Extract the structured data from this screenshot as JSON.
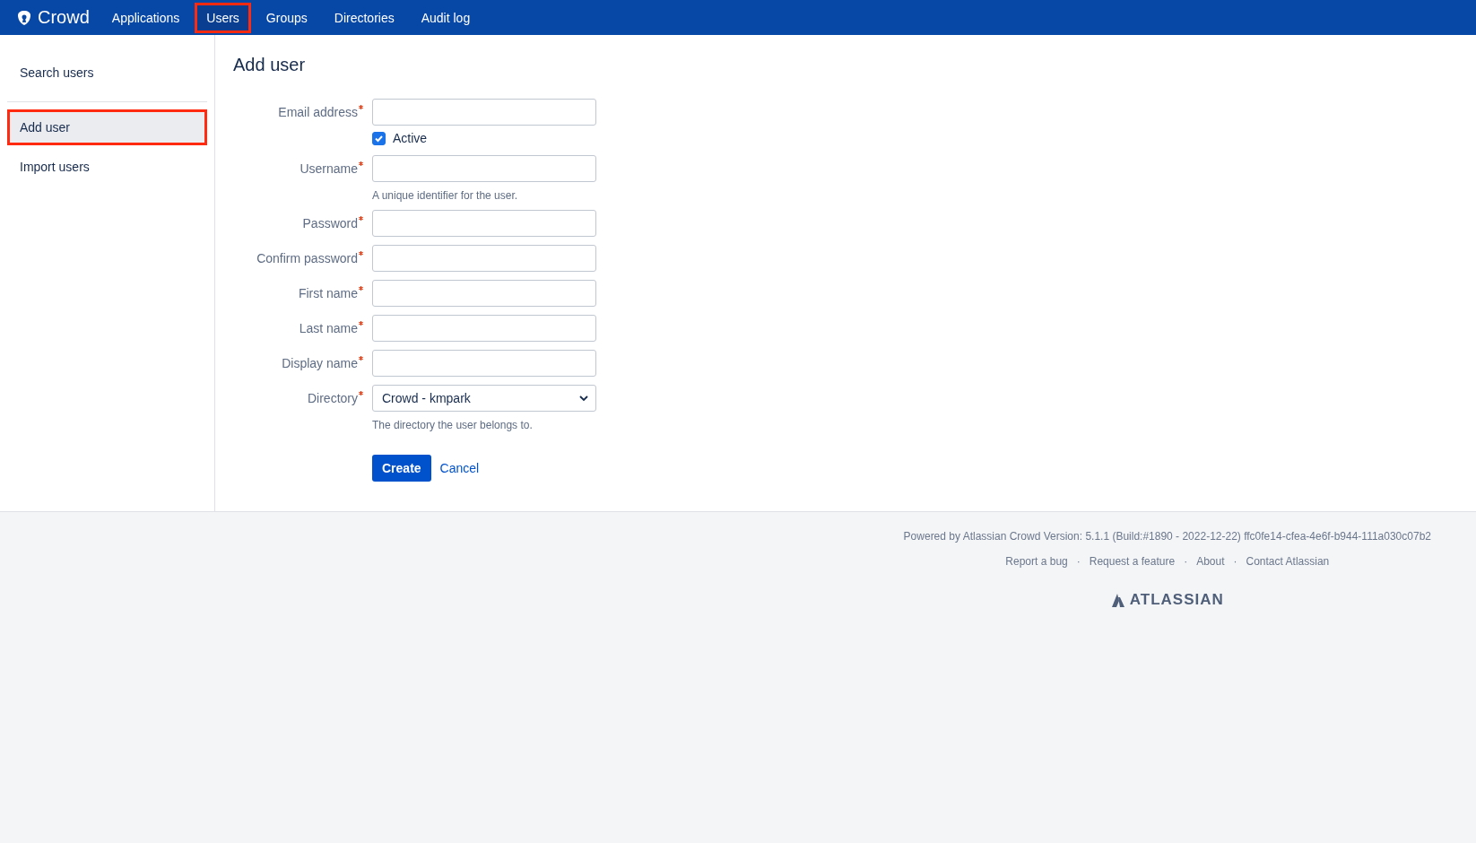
{
  "header": {
    "logo": "Crowd",
    "nav": [
      {
        "label": "Applications",
        "selected": false,
        "highlighted": false
      },
      {
        "label": "Users",
        "selected": true,
        "highlighted": true
      },
      {
        "label": "Groups",
        "selected": false,
        "highlighted": false
      },
      {
        "label": "Directories",
        "selected": false,
        "highlighted": false
      },
      {
        "label": "Audit log",
        "selected": false,
        "highlighted": false
      }
    ]
  },
  "sidebar": {
    "groups": [
      [
        {
          "label": "Search users",
          "selected": false,
          "highlighted": false
        }
      ],
      [
        {
          "label": "Add user",
          "selected": true,
          "highlighted": true
        },
        {
          "label": "Import users",
          "selected": false,
          "highlighted": false
        }
      ]
    ]
  },
  "form": {
    "title": "Add user",
    "fields": [
      {
        "kind": "text",
        "label": "Email address",
        "required": true
      },
      {
        "kind": "checkbox",
        "label": "Active",
        "checked": true
      },
      {
        "kind": "text",
        "label": "Username",
        "required": true,
        "hint": "A unique identifier for the user."
      },
      {
        "kind": "text",
        "label": "Password",
        "required": true
      },
      {
        "kind": "text",
        "label": "Confirm password",
        "required": true
      },
      {
        "kind": "text",
        "label": "First name",
        "required": true
      },
      {
        "kind": "text",
        "label": "Last name",
        "required": true
      },
      {
        "kind": "text",
        "label": "Display name",
        "required": true
      },
      {
        "kind": "select",
        "label": "Directory",
        "required": true,
        "value": "Crowd - kmpark",
        "hint": "The directory the user belongs to."
      }
    ],
    "submit": "Create",
    "cancel": "Cancel"
  },
  "footer": {
    "powered_by": "Powered by Atlassian Crowd Version: 5.1.1 (Build:#1890 - 2022-12-22) ffc0fe14-cfea-4e6f-b944-111a030c07b2",
    "links": [
      "Report a bug",
      "Request a feature",
      "About",
      "Contact Atlassian"
    ],
    "separator": "·",
    "logo": "ATLASSIAN"
  }
}
